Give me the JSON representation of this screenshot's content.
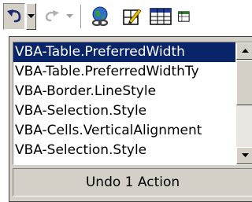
{
  "toolbar": {
    "buttons": [
      {
        "name": "undo-button",
        "icon": "undo-arrow-icon",
        "state": "pressed"
      },
      {
        "name": "undo-dropdown-button",
        "icon": "chevron-down-icon",
        "state": "raised"
      },
      {
        "name": "redo-button",
        "icon": "redo-arrow-icon",
        "state": "disabled"
      },
      {
        "name": "redo-dropdown-button",
        "icon": "chevron-down-icon",
        "state": "disabled"
      },
      {
        "name": "insert-hyperlink-button",
        "icon": "globe-link-icon"
      },
      {
        "name": "tables-and-borders-button",
        "icon": "draw-table-icon"
      },
      {
        "name": "insert-table-button",
        "icon": "table-grid-icon"
      },
      {
        "name": "insert-excel-button",
        "icon": "spreadsheet-icon"
      }
    ]
  },
  "undo_list": {
    "items": [
      "VBA-Table.PreferredWidth",
      "VBA-Table.PreferredWidthTy",
      "VBA-Border.LineStyle",
      "VBA-Selection.Style",
      "VBA-Cells.VerticalAlignment",
      "VBA-Selection.Style"
    ],
    "selected_index": 0
  },
  "status_text": "Undo 1 Action",
  "colors": {
    "selection": "#0a246a",
    "face": "#d4d0c8"
  }
}
